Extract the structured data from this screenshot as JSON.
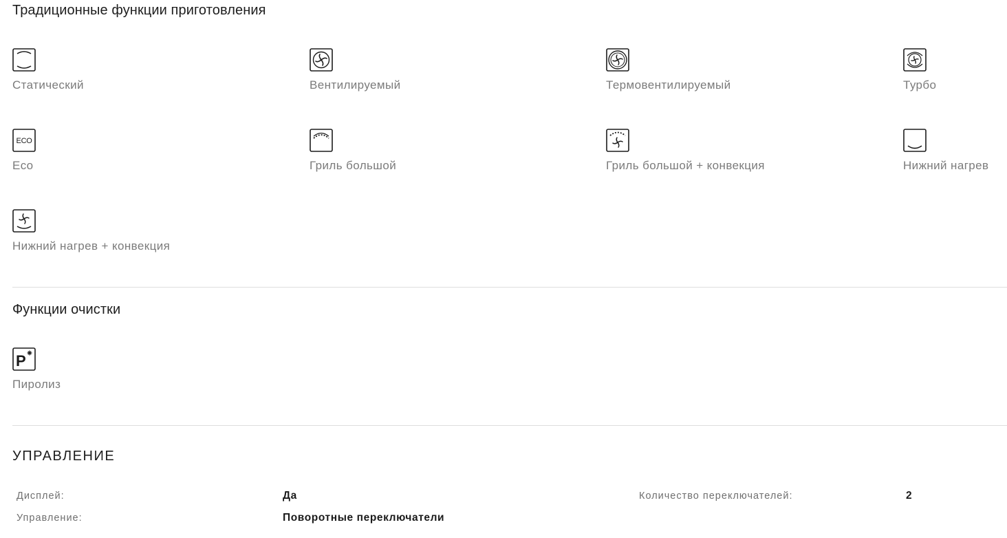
{
  "traditional_functions": {
    "title": "Традиционные функции приготовления",
    "items": [
      {
        "label": "Статический",
        "icon": "static-heat-icon"
      },
      {
        "label": "Вентилируемый",
        "icon": "fan-icon"
      },
      {
        "label": "Термовентилируемый",
        "icon": "ring-fan-icon"
      },
      {
        "label": "Турбо",
        "icon": "turbo-fan-icon"
      },
      {
        "label": "Eco",
        "icon": "eco-icon"
      },
      {
        "label": "Гриль большой",
        "icon": "full-grill-icon"
      },
      {
        "label": "Гриль большой + конвекция",
        "icon": "grill-fan-icon"
      },
      {
        "label": "Нижний нагрев",
        "icon": "bottom-heat-icon"
      },
      {
        "label": "Нижний нагрев + конвекция",
        "icon": "bottom-heat-fan-icon"
      }
    ]
  },
  "cleaning_functions": {
    "title": "Функции очистки",
    "items": [
      {
        "label": "Пиролиз",
        "icon": "pyrolysis-icon"
      }
    ]
  },
  "control": {
    "title": "УПРАВЛЕНИЕ",
    "specs": [
      {
        "label": "Дисплей:",
        "value": "Да"
      },
      {
        "label": "Количество переключателей:",
        "value": "2"
      },
      {
        "label": "Управление:",
        "value": "Поворотные переключатели"
      }
    ]
  },
  "colors": {
    "label_text": "#7b7b7b",
    "title_text": "#1d1d1d",
    "divider": "#dedede",
    "icon_stroke": "#1b1b1b"
  }
}
